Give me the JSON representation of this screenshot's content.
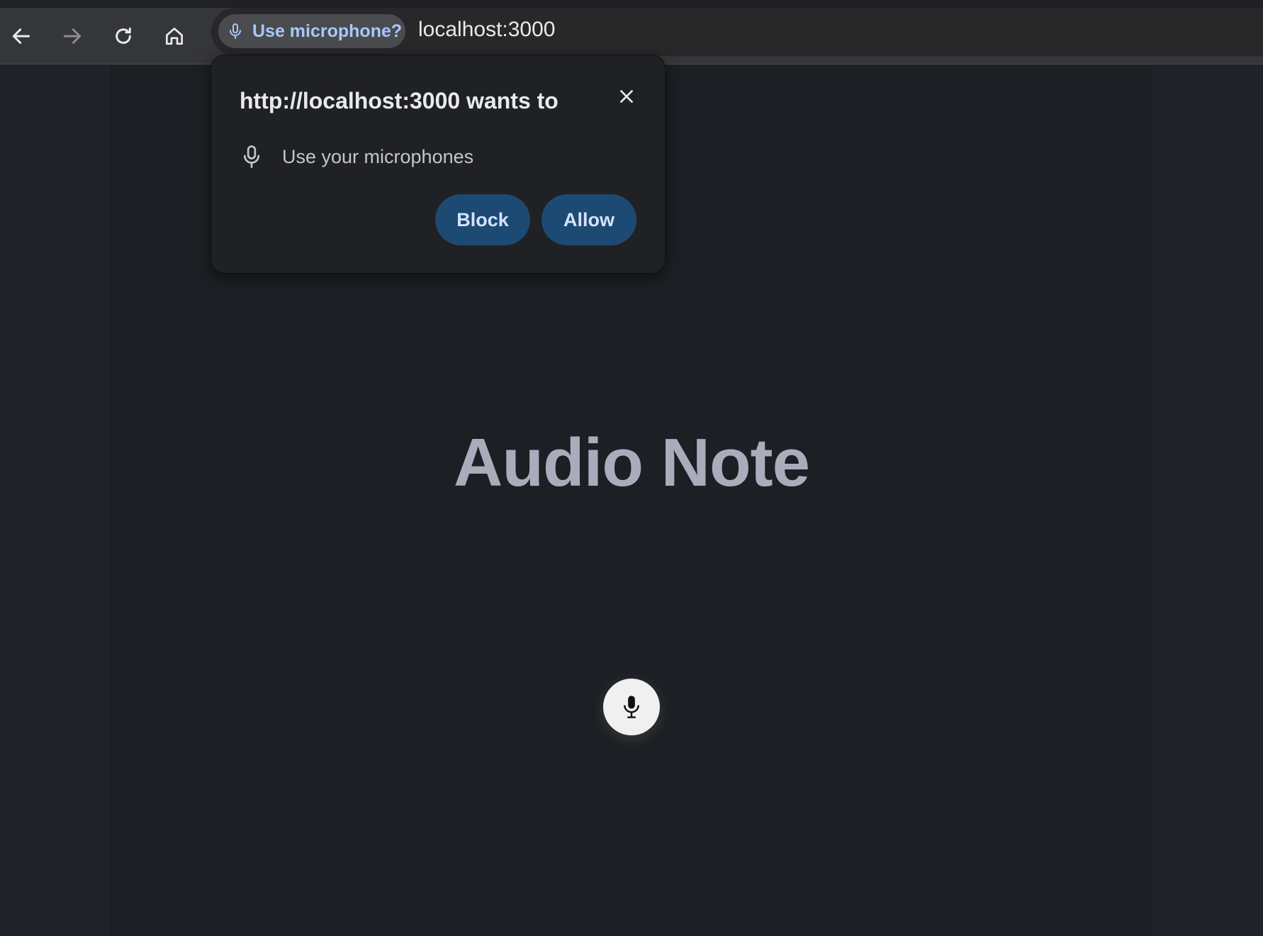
{
  "browser": {
    "permission_chip": "Use microphone?",
    "url": "localhost:3000",
    "accent_color": "#a8c7fa"
  },
  "permission_popup": {
    "title": "http://localhost:3000 wants to",
    "permission_label": "Use your microphones",
    "block_label": "Block",
    "allow_label": "Allow",
    "button_color": "#1d4a72"
  },
  "page": {
    "title": "Audio Note",
    "title_color": "#a9adbb",
    "background": "#1c1f24"
  },
  "icons": {
    "back": "arrow-left-icon",
    "forward": "arrow-right-icon",
    "reload": "reload-icon",
    "home": "home-icon",
    "chip": "microphone-icon",
    "close": "close-icon",
    "permission": "microphone-icon",
    "record": "microphone-icon"
  }
}
